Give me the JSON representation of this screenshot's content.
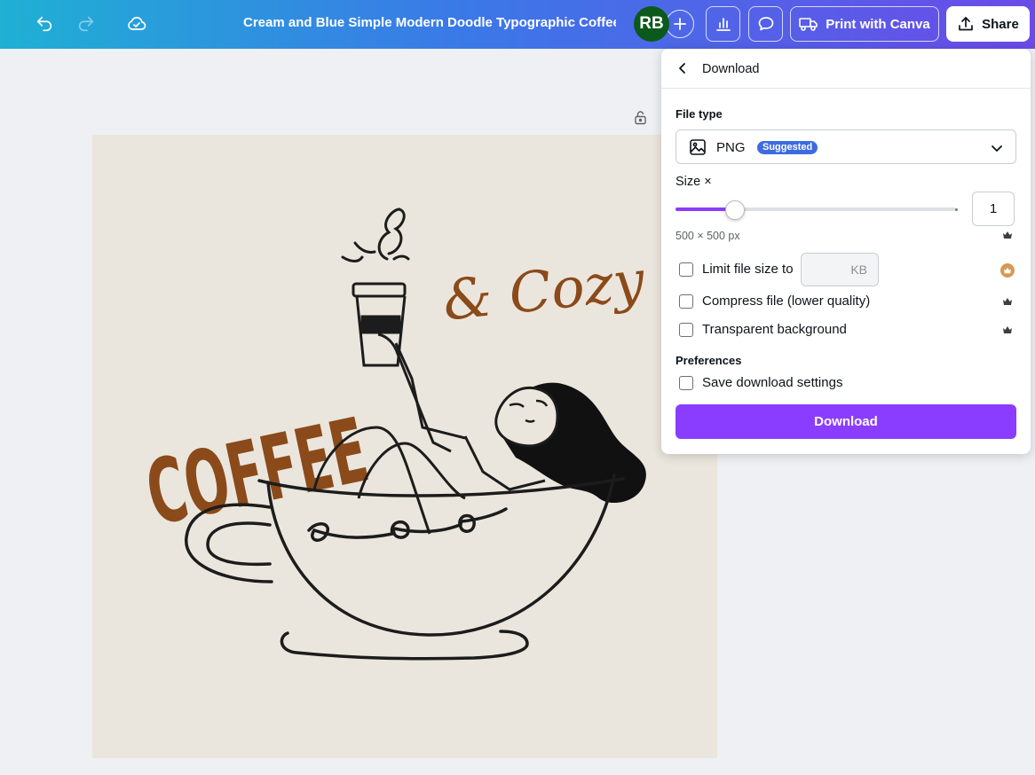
{
  "topbar": {
    "title": "Cream and Blue Simple Modern Doodle Typographic Coffee...",
    "avatar_initials": "RB",
    "print_label": "Print with Canva",
    "share_label": "Share",
    "icons": [
      "undo-icon",
      "redo-icon",
      "cloud-saved-icon",
      "plus-icon",
      "insights-icon",
      "comment-icon",
      "truck-icon",
      "share-upload-icon"
    ]
  },
  "design": {
    "headline_left": "COFFEE",
    "headline_right": "& Cozy",
    "colors": {
      "background": "#ebe6dd",
      "lettering": "#8b4a1a",
      "ink": "#1c1c1c"
    }
  },
  "download_panel": {
    "title": "Download",
    "file_type_label": "File type",
    "file_type_value": "PNG",
    "suggested_badge": "Suggested",
    "size_label": "Size ×",
    "size_value": "1",
    "size_slider_fraction": 0.21,
    "dimensions": "500 × 500 px",
    "limit_file_size_label": "Limit file size to",
    "kb_placeholder": "KB",
    "compress_label": "Compress file (lower quality)",
    "transparent_label": "Transparent background",
    "preferences_label": "Preferences",
    "save_settings_label": "Save download settings",
    "download_button": "Download",
    "accent_color": "#8b3dff"
  }
}
